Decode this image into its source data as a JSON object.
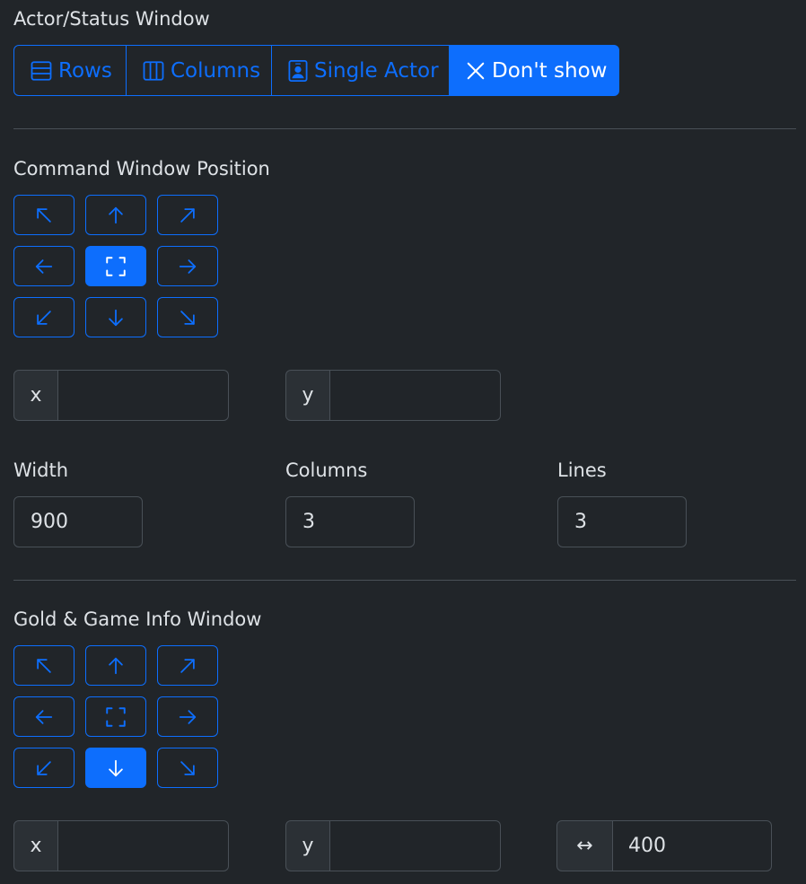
{
  "actor_status": {
    "title": "Actor/Status Window",
    "buttons": [
      {
        "label": "Rows",
        "icon": "rows-icon",
        "active": false
      },
      {
        "label": "Columns",
        "icon": "columns-icon",
        "active": false
      },
      {
        "label": "Single Actor",
        "icon": "person-badge-icon",
        "active": false
      },
      {
        "label": "Don't show",
        "icon": "x-icon",
        "active": true
      }
    ]
  },
  "command_window": {
    "title": "Command Window Position",
    "selected_position": "center",
    "x": {
      "label": "x",
      "value": ""
    },
    "y": {
      "label": "y",
      "value": ""
    },
    "width": {
      "label": "Width",
      "value": "900"
    },
    "columns": {
      "label": "Columns",
      "value": "3"
    },
    "lines": {
      "label": "Lines",
      "value": "3"
    }
  },
  "gold_window": {
    "title": "Gold & Game Info Window",
    "selected_position": "bottom",
    "x": {
      "label": "x",
      "value": ""
    },
    "y": {
      "label": "y",
      "value": ""
    },
    "width": {
      "label": "↔",
      "value": "400"
    }
  },
  "colors": {
    "background": "#212529",
    "primary": "#0d6efd",
    "border": "#495057",
    "addon": "#2b3035",
    "text": "#dee2e6"
  }
}
